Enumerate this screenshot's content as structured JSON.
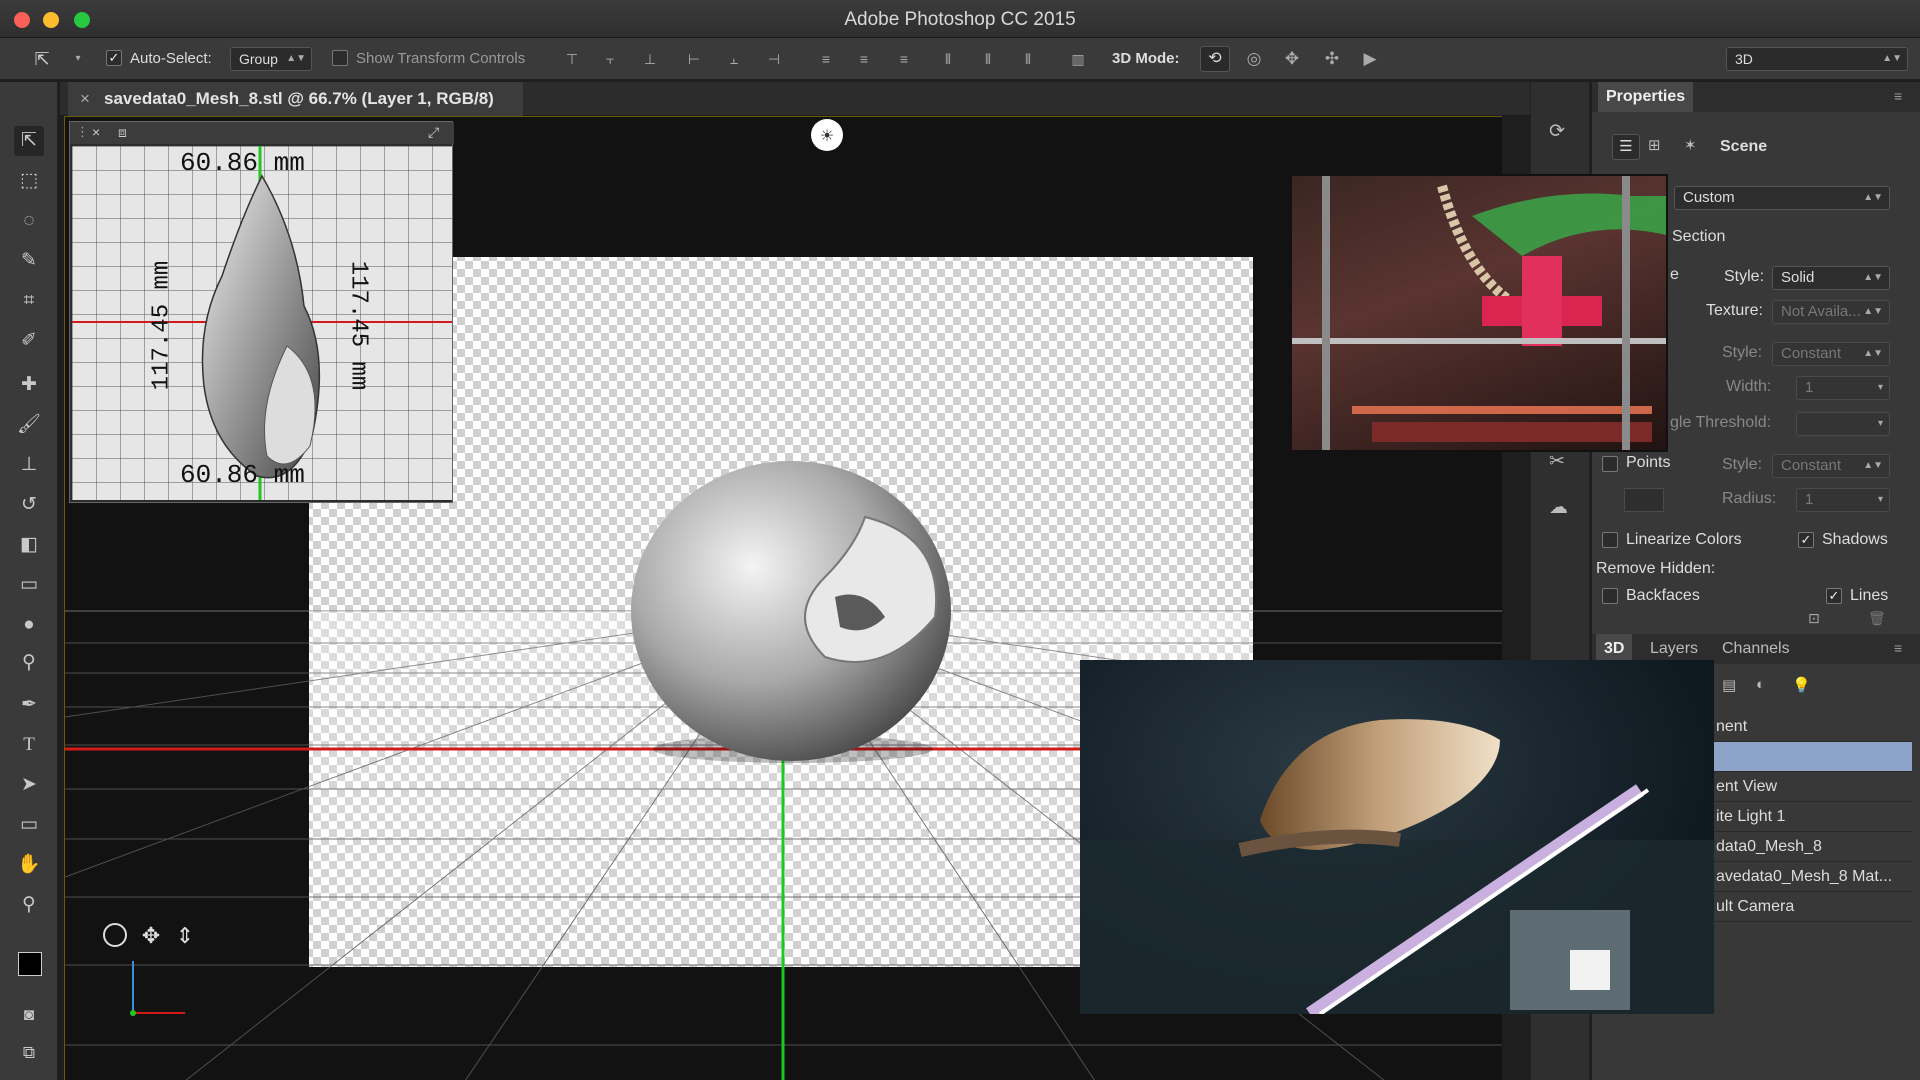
{
  "window": {
    "title": "Adobe Photoshop CC 2015"
  },
  "options_bar": {
    "auto_select_label": "Auto-Select:",
    "auto_select_checked": true,
    "auto_select_value": "Group",
    "show_transform_label": "Show Transform Controls",
    "mode_label": "3D Mode:",
    "workspace_value": "3D"
  },
  "document": {
    "tab_title": "savedata0_Mesh_8.stl @ 66.7% (Layer 1, RGB/8)",
    "close_glyph": "×"
  },
  "inset_view": {
    "top_measure": "60.86  mm",
    "bottom_measure": "60.86  mm",
    "left_measure": "117.45  mm",
    "right_measure": "117.45  mm"
  },
  "properties": {
    "tab": "Properties",
    "section_title": "Scene",
    "preset_value": "Custom",
    "cross_section_label": "Section",
    "surface_style_label": "Style:",
    "surface_style_value": "Solid",
    "texture_label": "Texture:",
    "texture_value": "Not Availa...",
    "lines_style_label": "Style:",
    "lines_style_value": "Constant",
    "width_label": "Width:",
    "width_value": "1",
    "angle_label": "gle Threshold:",
    "points_label": "Points",
    "points_style_label": "Style:",
    "points_style_value": "Constant",
    "radius_label": "Radius:",
    "radius_value": "1",
    "linearize_label": "Linearize Colors",
    "shadows_label": "Shadows",
    "remove_hidden_label": "Remove Hidden:",
    "backfaces_label": "Backfaces",
    "lines_label": "Lines",
    "surface_partial": "e"
  },
  "layers_panel": {
    "tabs": [
      "3D",
      "Layers",
      "Channels"
    ],
    "rows": [
      "nent",
      "",
      "ent View",
      "ite Light 1",
      "data0_Mesh_8",
      "avedata0_Mesh_8 Mat...",
      "ult Camera"
    ]
  },
  "colors": {
    "accent": "#8ea3c8",
    "red_axis": "#d21a1a",
    "green_axis": "#1ec81e"
  }
}
